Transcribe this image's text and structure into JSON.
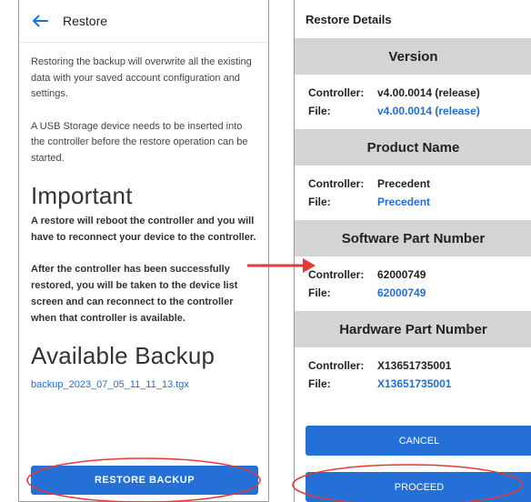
{
  "left": {
    "header_title": "Restore",
    "para1": "Restoring the backup will overwrite all the existing data with your saved account configuration and settings.",
    "para2": "A USB Storage device needs to be inserted into the controller before the restore operation can be started.",
    "important_heading": "Important",
    "important_para1": "A restore will reboot the controller and you will have to reconnect your device to the controller.",
    "important_para2": "After the controller has been successfully restored, you will be taken to the device list screen and can reconnect to the controller when that controller is available.",
    "available_heading": "Available Backup",
    "backup_file": "backup_2023_07_05_11_11_13.tgx",
    "restore_button": "RESTORE BACKUP"
  },
  "right": {
    "title": "Restore Details",
    "sections": [
      {
        "heading": "Version",
        "controller_label": "Controller:",
        "controller_value": "v4.00.0014 (release)",
        "file_label": "File:",
        "file_value": "v4.00.0014 (release)"
      },
      {
        "heading": "Product Name",
        "controller_label": "Controller:",
        "controller_value": "Precedent",
        "file_label": "File:",
        "file_value": "Precedent"
      },
      {
        "heading": "Software Part Number",
        "controller_label": "Controller:",
        "controller_value": "62000749",
        "file_label": "File:",
        "file_value": "62000749"
      },
      {
        "heading": "Hardware Part Number",
        "controller_label": "Controller:",
        "controller_value": "X13651735001",
        "file_label": "File:",
        "file_value": "X13651735001"
      }
    ],
    "cancel_button": "CANCEL",
    "proceed_button": "PROCEED"
  },
  "colors": {
    "accent": "#2470d6",
    "link": "#1f6fd0",
    "section_bg": "#d4d4d4",
    "annotation": "#e53935"
  },
  "icons": {
    "back": "arrow-left-icon"
  }
}
